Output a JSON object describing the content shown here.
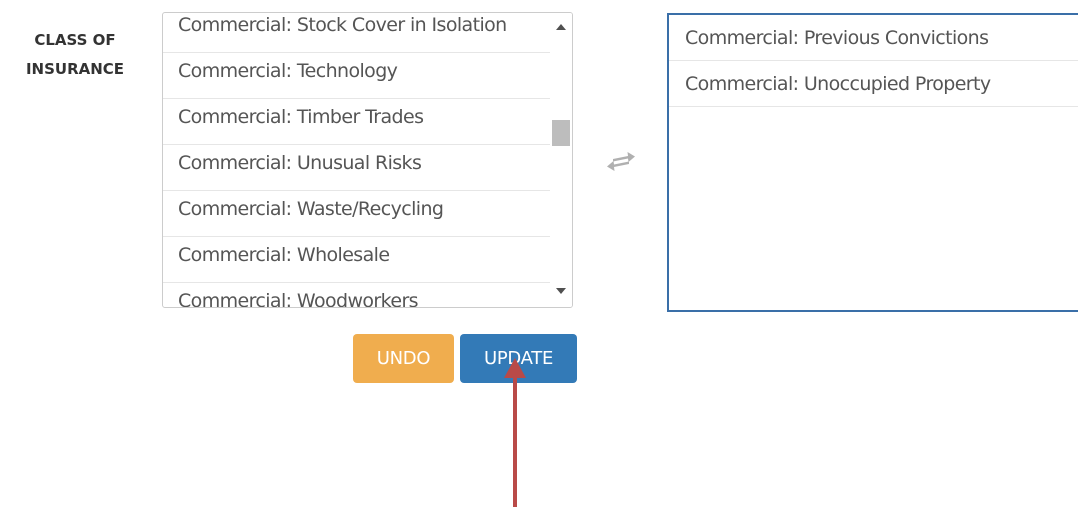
{
  "field": {
    "label_line1": "CLASS OF",
    "label_line2": "INSURANCE"
  },
  "available_list": {
    "items": [
      "Commercial: Stock Cover in Isolation",
      "Commercial: Technology",
      "Commercial: Timber Trades",
      "Commercial: Unusual Risks",
      "Commercial: Waste/Recycling",
      "Commercial: Wholesale",
      "Commercial: Woodworkers"
    ]
  },
  "selected_list": {
    "items": [
      "Commercial: Previous Convictions",
      "Commercial: Unoccupied Property"
    ]
  },
  "buttons": {
    "undo_label": "UNDO",
    "update_label": "UPDATE"
  },
  "colors": {
    "undo": "#f0ad4e",
    "update": "#337ab7",
    "selected_border": "#3a6fa8",
    "annotation_arrow": "#b94a48"
  },
  "icons": {
    "transfer": "transfer-arrows-icon",
    "annotation": "annotation-arrow"
  }
}
